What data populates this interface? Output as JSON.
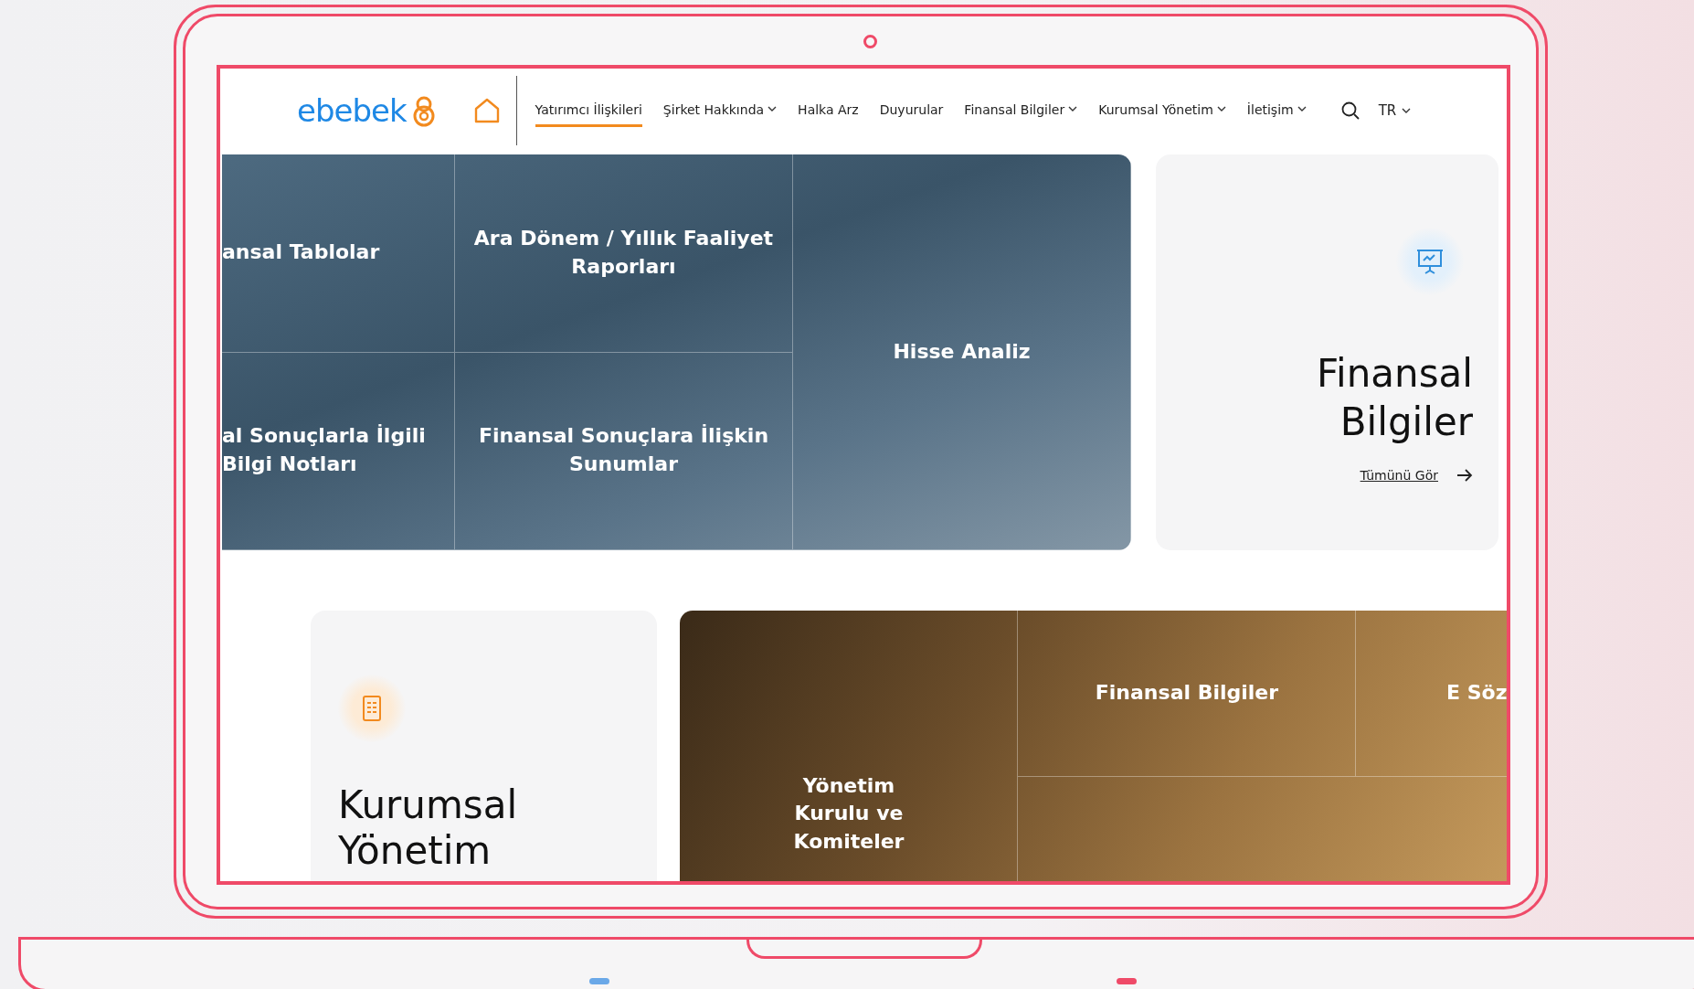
{
  "site": {
    "logo": "ebebek"
  },
  "nav": [
    {
      "label": "Yatırımcı İlişkileri",
      "selected": true,
      "dropdown": false
    },
    {
      "label": "Şirket Hakkında",
      "selected": false,
      "dropdown": true
    },
    {
      "label": "Halka Arz",
      "selected": false,
      "dropdown": false
    },
    {
      "label": "Duyurular",
      "selected": false,
      "dropdown": false
    },
    {
      "label": "Finansal Bilgiler",
      "selected": false,
      "dropdown": true
    },
    {
      "label": "Kurumsal Yönetim",
      "selected": false,
      "dropdown": true
    },
    {
      "label": "İletişim",
      "selected": false,
      "dropdown": true
    }
  ],
  "language": {
    "label": "TR"
  },
  "sections": [
    {
      "kind": "tiles-first",
      "tiles": [
        {
          "label": "ansal Tablolar"
        },
        {
          "label": "Ara Dönem / Yıllık Faaliyet Raporları"
        },
        {
          "label": "Hisse Analiz"
        },
        {
          "label": "al Sonuçlarla İlgili Bilgi Notları"
        },
        {
          "label": "Finansal Sonuçlara İlişkin Sunumlar"
        }
      ],
      "card": {
        "title": "Finansal Bilgiler",
        "link": "Tümünü Gör"
      }
    },
    {
      "kind": "card-first",
      "tiles": [
        {
          "label": "Finansal Bilgiler"
        },
        {
          "label": "E Söz"
        },
        {
          "label": "Yönetim Kurulu ve Komiteler"
        }
      ],
      "card": {
        "title": "Kurumsal Yönetim"
      }
    }
  ]
}
